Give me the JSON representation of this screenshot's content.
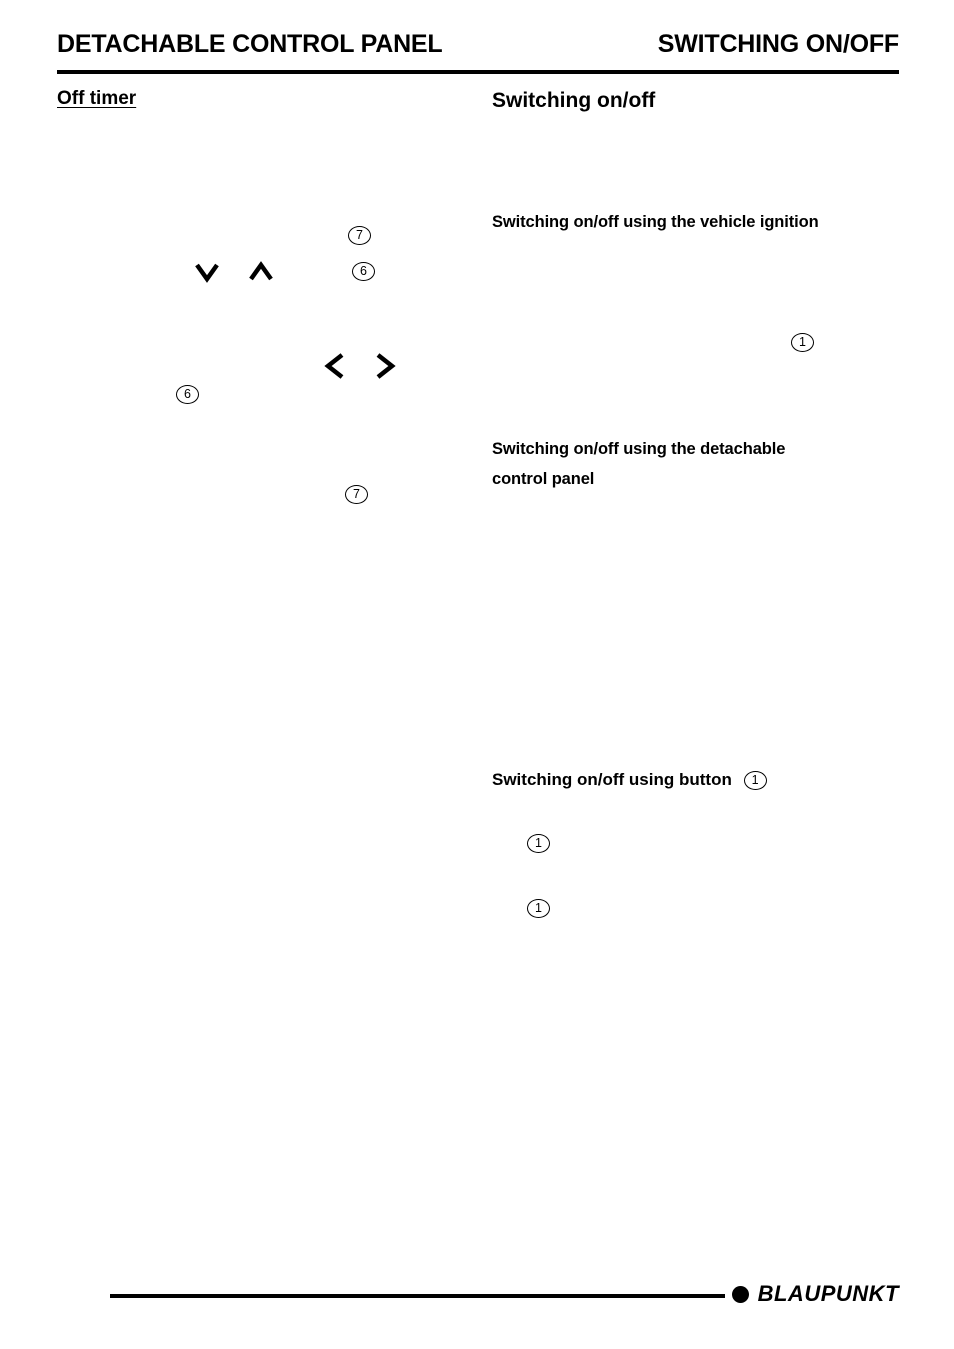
{
  "header": {
    "left_title": "DETACHABLE CONTROL PANEL",
    "right_title": "SWITCHING ON/OFF"
  },
  "left_column": {
    "section_title": "Off timer",
    "callouts": [
      {
        "id": "left-callout-7-top",
        "label": "7"
      },
      {
        "id": "left-callout-6-top",
        "label": "6"
      },
      {
        "id": "left-callout-6-mid",
        "label": "6"
      },
      {
        "id": "left-callout-7-bottom",
        "label": "7"
      }
    ],
    "glyphs": [
      {
        "id": "down-chevron",
        "name": "chevron-down-icon"
      },
      {
        "id": "up-chevron",
        "name": "chevron-up-icon"
      },
      {
        "id": "left-chevron",
        "name": "chevron-left-icon"
      },
      {
        "id": "right-chevron",
        "name": "chevron-right-icon"
      }
    ]
  },
  "right_column": {
    "section_title": "Switching on/off",
    "sub_head_1": "Switching on/off using the vehicle ignition",
    "sub_head_2": "Switching on/off using the detachable control panel",
    "sub_head_3": "Switching on/off using button",
    "callouts": [
      {
        "id": "right-callout-1-ignition",
        "label": "1"
      },
      {
        "id": "right-callout-1-inline",
        "label": "1"
      },
      {
        "id": "right-callout-1-step1",
        "label": "1"
      },
      {
        "id": "right-callout-1-step2",
        "label": "1"
      }
    ]
  },
  "footer": {
    "brand": "BLAUPUNKT"
  }
}
